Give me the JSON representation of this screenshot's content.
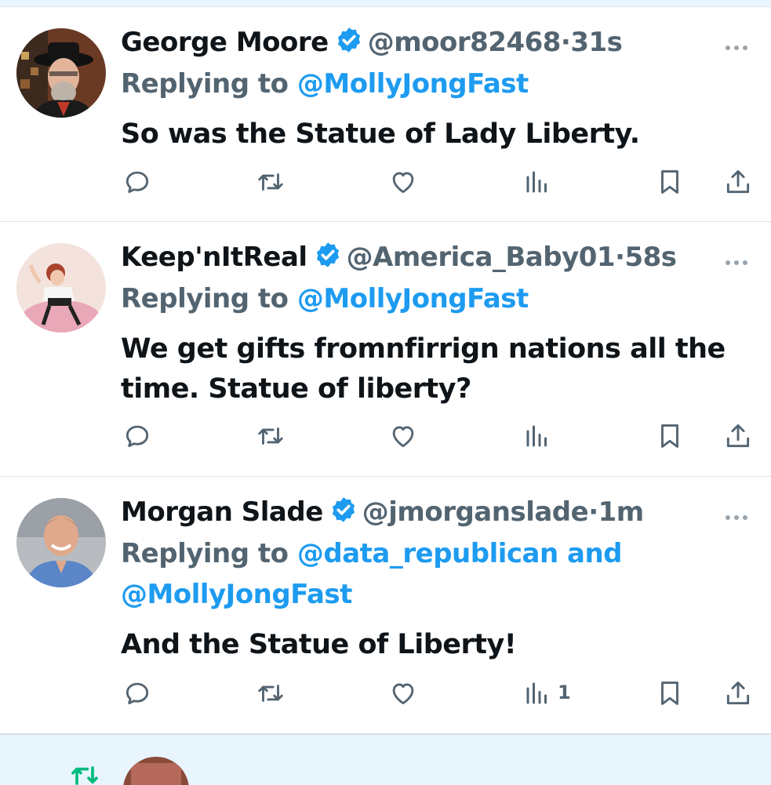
{
  "tweets": [
    {
      "name": "George Moore",
      "handle": "@moor82468",
      "separator": "·",
      "time": "31s",
      "replying_label": "Replying to ",
      "replying_to": "@MollyJongFast",
      "replying_to_more": "",
      "content": "So was the Statue of Lady Liberty.",
      "views": ""
    },
    {
      "name": "Keep'nItReal",
      "handle": "@America_Baby01",
      "separator": "·",
      "time": "58s",
      "replying_label": "Replying to ",
      "replying_to": "@MollyJongFast",
      "replying_to_more": "",
      "content": "We get gifts fromnfirrign nations all the time.  Statue of liberty?",
      "views": ""
    },
    {
      "name": "Morgan Slade",
      "handle": "@jmorganslade",
      "separator": "·",
      "time": "1m",
      "replying_label": "Replying to ",
      "replying_to": "@data_republican and",
      "replying_to_more": "@MollyJongFast",
      "content": "And the Statue of Liberty!",
      "views": "1"
    }
  ],
  "icons": [
    "reply-icon",
    "retweet-icon",
    "like-icon",
    "views-icon",
    "bookmark-icon",
    "share-icon",
    "verified-badge-icon",
    "more-options-icon"
  ],
  "colors": {
    "link": "#1d9bf0",
    "secondary_text": "#536471",
    "primary_text": "#0f1419",
    "verified": "#1d9bf0",
    "retweet_green": "#00ba7c",
    "highlight_bg": "#e8f5fd"
  }
}
